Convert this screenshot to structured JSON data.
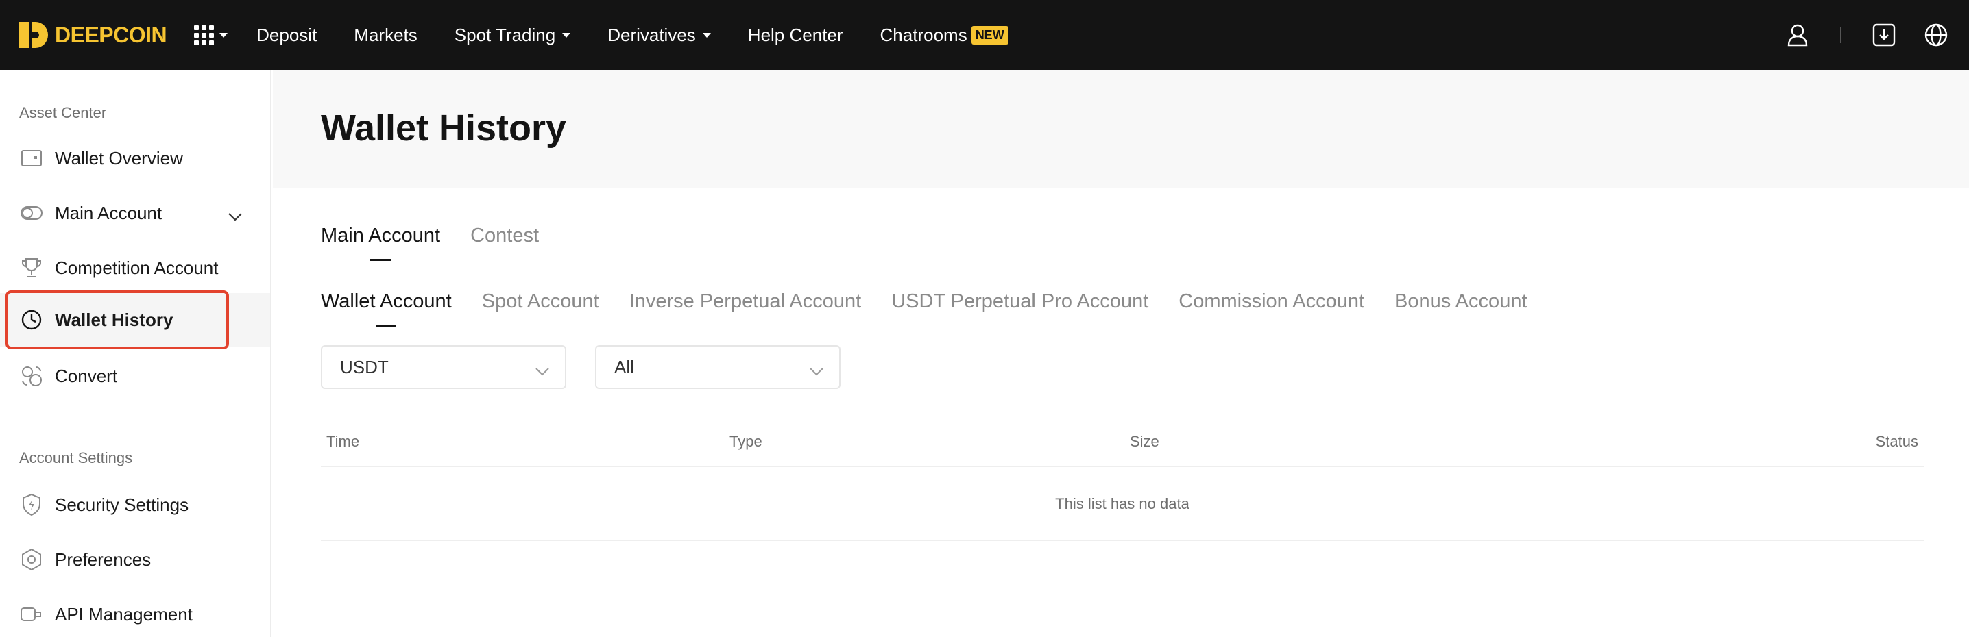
{
  "brand": {
    "name": "DEEPCOIN",
    "color": "#f6c431"
  },
  "nav": {
    "apps_icon": "apps-grid-icon",
    "items": [
      {
        "label": "Deposit",
        "has_dropdown": false
      },
      {
        "label": "Markets",
        "has_dropdown": false
      },
      {
        "label": "Spot Trading",
        "has_dropdown": true
      },
      {
        "label": "Derivatives",
        "has_dropdown": true
      },
      {
        "label": "Help Center",
        "has_dropdown": false
      },
      {
        "label": "Chatrooms",
        "has_dropdown": false,
        "badge": "NEW"
      }
    ],
    "right_icons": [
      "user-icon",
      "download-icon",
      "globe-icon"
    ]
  },
  "sidebar": {
    "asset_center_label": "Asset Center",
    "account_settings_label": "Account Settings",
    "items": [
      {
        "label": "Wallet Overview",
        "icon": "wallet-icon"
      },
      {
        "label": "Main Account",
        "icon": "toggle-icon",
        "expandable": true
      },
      {
        "label": "Competition Account",
        "icon": "trophy-icon"
      },
      {
        "label": "Wallet History",
        "icon": "clock-icon",
        "active": true
      },
      {
        "label": "Convert",
        "icon": "convert-icon"
      }
    ],
    "settings_items": [
      {
        "label": "Security Settings",
        "icon": "shield-icon"
      },
      {
        "label": "Preferences",
        "icon": "hexagon-icon"
      },
      {
        "label": "API Management",
        "icon": "api-icon"
      }
    ],
    "highlight_color": "#e3432e"
  },
  "main": {
    "title": "Wallet History",
    "account_tabs": [
      {
        "label": "Main Account",
        "active": true
      },
      {
        "label": "Contest",
        "active": false
      }
    ],
    "wallet_tabs": [
      {
        "label": "Wallet Account",
        "active": true
      },
      {
        "label": "Spot Account",
        "active": false
      },
      {
        "label": "Inverse Perpetual Account",
        "active": false
      },
      {
        "label": "USDT Perpetual Pro Account",
        "active": false
      },
      {
        "label": "Commission Account",
        "active": false
      },
      {
        "label": "Bonus Account",
        "active": false
      }
    ],
    "filters": {
      "currency": "USDT",
      "type": "All"
    },
    "table": {
      "columns": [
        "Time",
        "Type",
        "Size",
        "Status"
      ],
      "empty_text": "This list has no data"
    }
  }
}
